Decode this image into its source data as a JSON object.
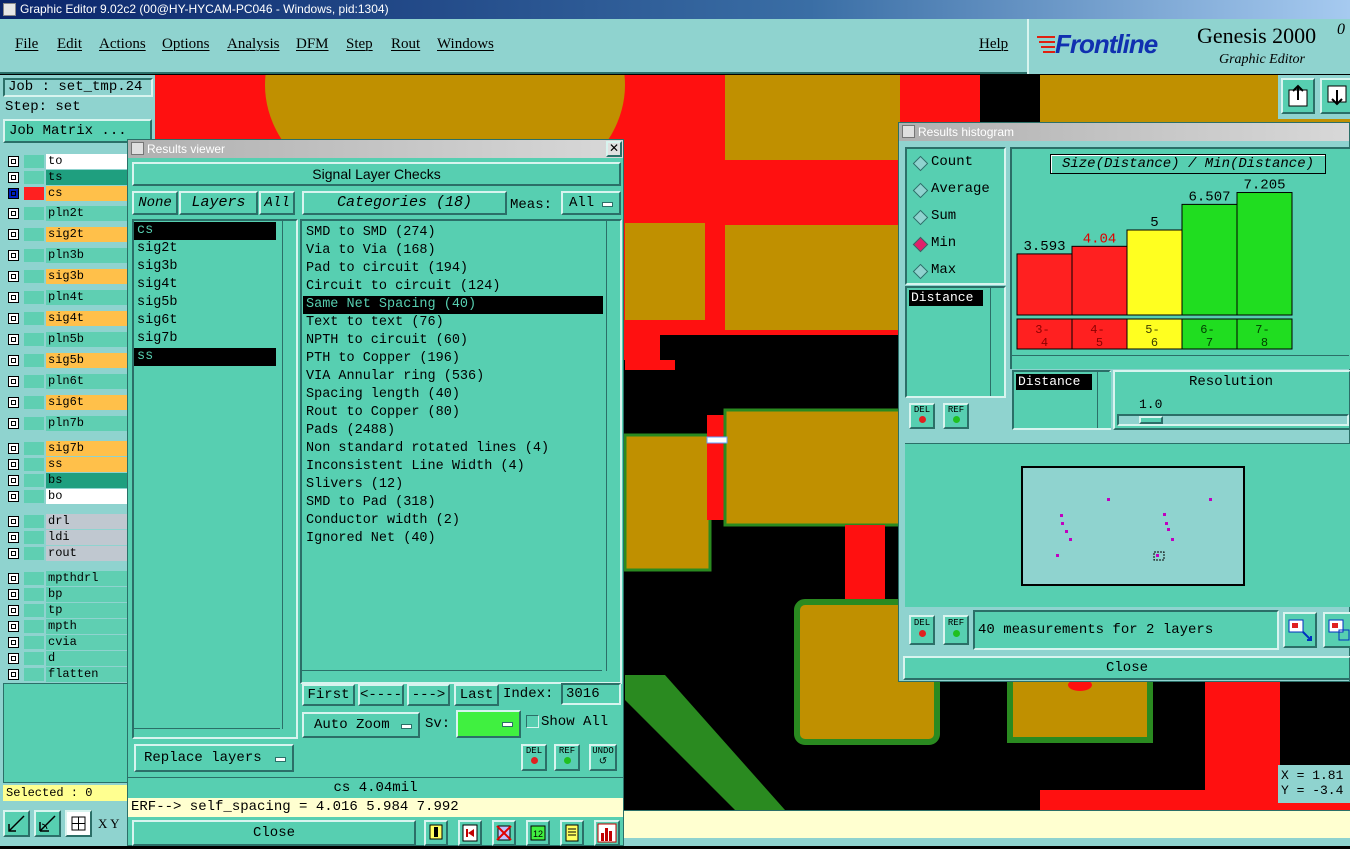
{
  "app": {
    "title": "Graphic Editor 9.02c2 (00@HY-HYCAM-PC046 - Windows, pid:1304)"
  },
  "menu": {
    "items": [
      "File",
      "Edit",
      "Actions",
      "Options",
      "Analysis",
      "DFM",
      "Step",
      "Rout",
      "Windows"
    ],
    "help": "Help"
  },
  "brand": {
    "logo": "Frontline",
    "product": "Genesis 2000",
    "version_frag": "0",
    "subtitle": "Graphic Editor"
  },
  "job": {
    "job_label": "Job : set_tmp.24",
    "step_label": "Step: set",
    "matrix_button": "Job Matrix ..."
  },
  "layers": [
    {
      "name": "to",
      "color": "#ffffff"
    },
    {
      "name": "ts",
      "color": "#1f9f7f"
    },
    {
      "name": "cs",
      "color": "#ffc04a",
      "active": true
    },
    {
      "name": "pln2t",
      "color": "#5fcfb2"
    },
    {
      "name": "sig2t",
      "color": "#ffc04a"
    },
    {
      "name": "pln3b",
      "color": "#5fcfb2"
    },
    {
      "name": "sig3b",
      "color": "#ffc04a"
    },
    {
      "name": "pln4t",
      "color": "#5fcfb2"
    },
    {
      "name": "sig4t",
      "color": "#ffc04a"
    },
    {
      "name": "pln5b",
      "color": "#5fcfb2"
    },
    {
      "name": "sig5b",
      "color": "#ffc04a"
    },
    {
      "name": "pln6t",
      "color": "#5fcfb2"
    },
    {
      "name": "sig6t",
      "color": "#ffc04a"
    },
    {
      "name": "pln7b",
      "color": "#5fcfb2"
    },
    {
      "name": "sig7b",
      "color": "#ffc04a"
    },
    {
      "name": "ss",
      "color": "#ffc04a"
    },
    {
      "name": "bs",
      "color": "#1f9f7f"
    },
    {
      "name": "bo",
      "color": "#ffffff"
    },
    {
      "name": "drl",
      "color": "#c0c8d0"
    },
    {
      "name": "ldi",
      "color": "#c0c8d0"
    },
    {
      "name": "rout",
      "color": "#c0c8d0"
    },
    {
      "name": "mpthdrl",
      "color": "#5fcfb2"
    },
    {
      "name": "bp",
      "color": "#5fcfb2"
    },
    {
      "name": "tp",
      "color": "#5fcfb2"
    },
    {
      "name": "mpth",
      "color": "#5fcfb2"
    },
    {
      "name": "cvia",
      "color": "#5fcfb2"
    },
    {
      "name": "d",
      "color": "#5fcfb2"
    },
    {
      "name": "flatten",
      "color": "#5fcfb2"
    }
  ],
  "status": {
    "selected": "Selected : 0",
    "xy_label": "X Y",
    "x": "X = 1.81",
    "y": "Y = -3.4"
  },
  "results_viewer": {
    "title": "Results viewer",
    "header": "Signal Layer Checks",
    "none_btn": "None",
    "layers_btn": "Layers",
    "all_btn": "All",
    "categories_btn": "Categories (18)",
    "meas_label": "Meas:",
    "meas_value": "All",
    "layer_list": [
      "cs",
      "sig2t",
      "sig3b",
      "sig4t",
      "sig5b",
      "sig6t",
      "sig7b",
      "ss"
    ],
    "categories": [
      "SMD to SMD (274)",
      "Via to Via (168)",
      "Pad to circuit (194)",
      "Circuit to circuit (124)",
      "Same Net Spacing (40)",
      "Text to text (76)",
      "NPTH to circuit (60)",
      "PTH to Copper (196)",
      "VIA Annular ring (536)",
      "Spacing length (40)",
      "Rout to Copper (80)",
      "Pads (2488)",
      "Non standard rotated lines (4)",
      "Inconsistent Line Width (4)",
      "Slivers (12)",
      "SMD to Pad (318)",
      "Conductor width (2)",
      "Ignored Net (40)"
    ],
    "selected_category": "Same Net Spacing (40)",
    "nav": {
      "first": "First",
      "prev": "<----",
      "next": "--->",
      "last": "Last",
      "index_label": "Index:",
      "index_value": "3016"
    },
    "auto_zoom": "Auto Zoom",
    "sv_label": "Sv:",
    "show_all": "Show All",
    "replace_layers": "Replace layers",
    "del": "DEL",
    "ref": "REF",
    "undo": "UNDO",
    "info": "cs 4.04mil",
    "erf": "ERF--> self_spacing = 4.016 5.984 7.992",
    "close": "Close"
  },
  "histogram": {
    "title": "Results histogram",
    "modes": [
      "Count",
      "Average",
      "Sum",
      "Min",
      "Max"
    ],
    "active_mode": "Min",
    "chart_title": "Size(Distance) / Min(Distance)",
    "distance_label": "Distance",
    "distance_label2": "Distance",
    "resolution_label": "Resolution",
    "resolution_value": "1.0",
    "measurements": "40 measurements for 2 layers",
    "close": "Close",
    "del": "DEL",
    "ref": "REF"
  },
  "chart_data": {
    "type": "bar",
    "title": "Size(Distance) / Min(Distance)",
    "categories": [
      "3-4",
      "4-5",
      "5-6",
      "6-7",
      "7-8"
    ],
    "values": [
      3.593,
      4.04,
      5,
      6.507,
      7.205
    ],
    "value_labels": [
      "3.593",
      "4.04",
      "5",
      "6.507",
      "7.205"
    ],
    "colors": [
      "#ff2020",
      "#ff2020",
      "#ffff20",
      "#20dd20",
      "#20dd20"
    ],
    "ylim": [
      0,
      8
    ]
  }
}
